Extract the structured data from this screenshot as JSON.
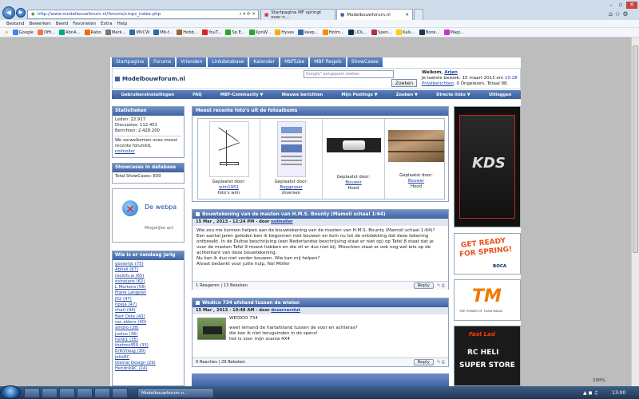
{
  "browser": {
    "url": "http://www.modelbouwforum.nl/forums/cmps_index.php",
    "tabs": [
      {
        "label": "Startpagina MF springt over n..."
      },
      {
        "label": "Modelbouwforum.nl"
      }
    ],
    "menu": [
      "Bestand",
      "Bewerken",
      "Beeld",
      "Favorieten",
      "Extra",
      "Help"
    ],
    "favorites": [
      "Google",
      "Offi...",
      "AbnA...",
      "Rabo",
      "Mark...",
      "MVCW",
      "Mb-f...",
      "Hobb...",
      "YouT...",
      "Sp E...",
      "KpnW...",
      "Hyves",
      "keep...",
      "Hotm...",
      "LIDL...",
      "Spen...",
      "Kals...",
      "Book...",
      "Magi..."
    ],
    "zoom": "100%"
  },
  "site": {
    "tabs": [
      "Startpagina",
      "Forums",
      "Vrienden",
      "Linkdatabase",
      "Kalender",
      "MbfTube",
      "MBF Regels",
      "ShowCases"
    ],
    "logo": "Modelbouwforum.nl",
    "search_placeholder": "Google\" aangepast zoeken",
    "search_button": "Zoeken",
    "welcome": {
      "prefix": "Welkom,",
      "user": "Arjen",
      "last_visit": "Je laatste bezoek: 15 maart 2013 om",
      "last_time": "10:28",
      "pm_link": "Privéberichten",
      "pm_text": ": 0 Ongelezen, Totaal 98."
    },
    "subnav": [
      "Gebruikersinstellingen",
      "FAQ",
      "MBF-Community ▼",
      "Nieuwe berichten",
      "Mijn Postings ▼",
      "Zoeken ▼",
      "Directe links ▼",
      "Uitloggen"
    ]
  },
  "sidebar": {
    "stats": {
      "title": "Statistieken",
      "lines": [
        "Leden: 22.917",
        "Discussies: 112.451",
        "Berichten: 2.428.200"
      ],
      "welcome_text": "We verwelkomen onze meest recente forumlid,",
      "newest": "nolmoller"
    },
    "showcases": {
      "title": "Showcases in database",
      "text": "Total ShowCases: 830"
    },
    "error_box": {
      "title": "De webpa",
      "text": "Mogelijke act"
    },
    "birthdays": {
      "title": "Wie is er vandaag jarig",
      "items": [
        "gosiertje (75)",
        "Abhali (67)",
        "roelofs.w (65)",
        "esinejans (62)",
        "L Mertens (56)",
        "Frank Langeler",
        "J02 (47)",
        "npeja (47)",
        "charl (44)",
        "Bart Oste (43)",
        "ron alders (40)",
        "amdro (38)",
        "Justus (36)",
        "henk1 (35)",
        "thetrex450 (33)",
        "ErikVreug (30)",
        "JelleRC",
        "Dismal Design (29)",
        "HendrikRC (24)"
      ]
    }
  },
  "photos": {
    "title": "Meest recente foto's uit de fotoalbums",
    "items": [
      {
        "label": "Geplaatst door:",
        "user": "wim1951",
        "caption": "foto's wim"
      },
      {
        "label": "Geplaatst door:",
        "user": "Baggerpar",
        "caption": "diversen"
      },
      {
        "label": "Geplaatst door:",
        "user": "Bouwer",
        "caption": "Hood"
      },
      {
        "label": "Geplaatst door:",
        "user": "Bouwer",
        "caption": "Hood"
      }
    ]
  },
  "posts": [
    {
      "title": "Bouwtekening van de masten van H.M.S. Bounty (Mamoli schaal 1:64)",
      "meta": "15 Mar , 2013 - 12:24 PM - door",
      "author": "nolmoller",
      "body": "Wie zou me kunnen helpen aan de bouwtekening van de masten van H.M.S. Bounty (Mamoli schaal 1:64)? Een aantal jaren geleden ben ik begonnen met bouwen en kom nu tot de ontdekking dat deze tekening ontbreekt. In de Duitse beschrijving (een Nederlandse beschrijving staat er niet op) op Tafel 8 staat dat je voor de masten Tafel 9 moest hebben en die zit er dus niet bij. Misschien staat er ook nog wel iets op de achterkant van deze bouwtekening.",
      "body2": "Nu kan ik dus niet verder bouwen. Wie kan mij helpen?",
      "body3": "Alvast bedankt voor jullie hulp, Nol Möller",
      "footer": "1 Reageren | 13 Bekeken",
      "reply": "Reply"
    },
    {
      "title": "Wedico 734 afstand tussen de wielen",
      "meta": "15 Mar , 2013 - 10:48 AM - door",
      "author": "dcserverslut",
      "body_lines": [
        "WEDICO 734",
        "weet iemand de hartafstand tussen de voor en achteras?",
        "die kan ik niet terugvinden in de specs!",
        "het is voor mijn scania 4X4"
      ],
      "footer": "0 Reacties | 29 Bekeken",
      "reply": "Reply"
    }
  ],
  "ads": [
    {
      "text": "KDS"
    },
    {
      "line1": "GET READY",
      "line2": "FOR SPRING!",
      "brand": "BOCA"
    },
    {
      "logo": "TM",
      "tag": "THE POWER OF TEAM MAGIC"
    },
    {
      "brand": "Fast Lad",
      "line1": "RC HELI",
      "line2": "SUPER STORE"
    }
  ],
  "taskbar": {
    "window": "Modelbouwforum.n...",
    "time": "13:00"
  }
}
